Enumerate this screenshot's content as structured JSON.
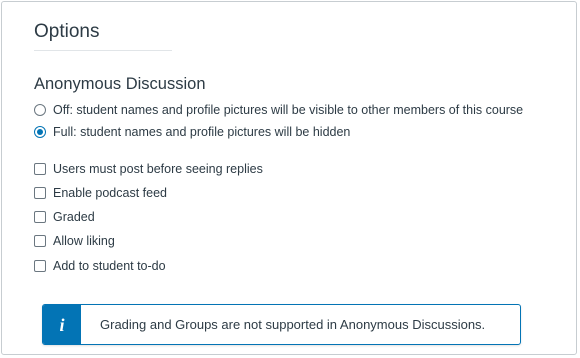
{
  "panel": {
    "title": "Options",
    "anonymous": {
      "heading": "Anonymous Discussion",
      "options": [
        {
          "label": "Off: student names and profile pictures will be visible to other members of this course",
          "selected": false
        },
        {
          "label": "Full: student names and profile pictures will be hidden",
          "selected": true
        }
      ]
    },
    "checkboxes": [
      {
        "label": "Users must post before seeing replies",
        "checked": false
      },
      {
        "label": "Enable podcast feed",
        "checked": false
      },
      {
        "label": "Graded",
        "checked": false
      },
      {
        "label": "Allow liking",
        "checked": false
      },
      {
        "label": "Add to student to-do",
        "checked": false
      }
    ],
    "alert": {
      "icon": "info-icon",
      "icon_glyph": "i",
      "message": "Grading and Groups are not supported in Anonymous Discussions."
    }
  },
  "colors": {
    "accent": "#0374b5",
    "text": "#2d3b45",
    "border": "#c7cdd1"
  }
}
